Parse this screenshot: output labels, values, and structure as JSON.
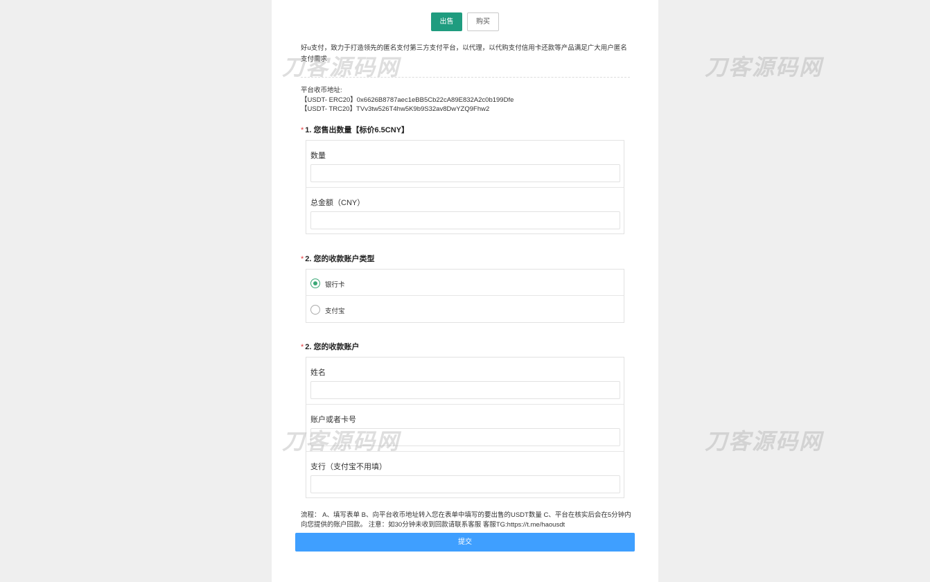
{
  "watermark_text": "刀客源码网",
  "tabs": {
    "sell": "出售",
    "buy": "购买"
  },
  "intro": "好u支付，致力于打造领先的匿名支付第三方支付平台，以代理，以代购支付信用卡还款等产品满足广大用户匿名支付需求",
  "platform_address": {
    "label": "平台收币地址:",
    "erc20": "【USDT- ERC20】0x6626B8787aec1eBB5Cb22cA89E832A2c0b199Dfe",
    "trc20": "【USDT- TRC20】TVv3tw526T4hw5K9b9S32av8DwYZQ9Fhw2"
  },
  "q1": {
    "required_mark": "*",
    "title": "1. 您售出数量【标价6.5CNY】",
    "fields": {
      "quantity_label": "数量",
      "total_label": "总金额（CNY）"
    }
  },
  "q2": {
    "required_mark": "*",
    "title": "2. 您的收款账户类型",
    "options": {
      "bank": "银行卡",
      "alipay": "支付宝"
    },
    "selected": "bank"
  },
  "q3": {
    "required_mark": "*",
    "title": "2. 您的收款账户",
    "fields": {
      "name_label": "姓名",
      "account_label": "账户或者卡号",
      "branch_label": "支行（支付宝不用填）"
    }
  },
  "process_note": "流程： A、填写表单 B、向平台收币地址转入您在表单中填写的要出售的USDT数量 C、平台在核实后会在5分钟内向您提供的账户回款。 注意：如30分钟未收到回款请联系客服 客服TG:https://t.me/haousdt",
  "submit_label": "提交",
  "colors": {
    "accent_green": "#1f9c7f",
    "submit_blue": "#3f9fff",
    "required_red": "#e4393c",
    "page_bg": "#efefef"
  }
}
